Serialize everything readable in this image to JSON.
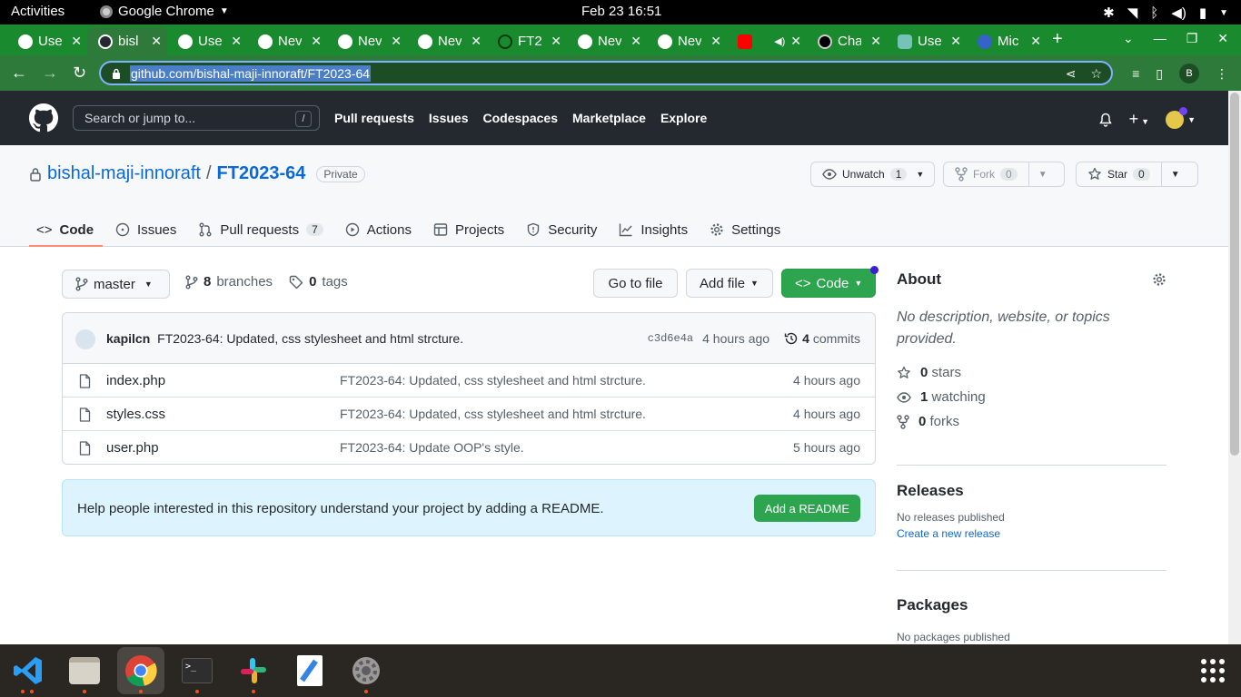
{
  "system": {
    "activities": "Activities",
    "app_name": "Google Chrome",
    "clock": "Feb 23  16:51"
  },
  "tabs": [
    {
      "title": "Use",
      "active": false
    },
    {
      "title": "bisl",
      "active": true
    },
    {
      "title": "Use",
      "active": false
    },
    {
      "title": "Nev",
      "active": false
    },
    {
      "title": "Nev",
      "active": false
    },
    {
      "title": "Nev",
      "active": false
    },
    {
      "title": "FT2",
      "active": false
    },
    {
      "title": "Nev",
      "active": false
    },
    {
      "title": "Nev",
      "active": false
    },
    {
      "title": "",
      "active": false
    },
    {
      "title": "Cha",
      "active": false
    },
    {
      "title": "Use",
      "active": false
    },
    {
      "title": "Mic",
      "active": false
    }
  ],
  "browser": {
    "url": "github.com/bishal-maji-innoraft/FT2023-64",
    "profile_initial": "B"
  },
  "github": {
    "search_placeholder": "Search or jump to...",
    "search_key": "/",
    "nav": [
      "Pull requests",
      "Issues",
      "Codespaces",
      "Marketplace",
      "Explore"
    ]
  },
  "repo": {
    "owner": "bishal-maji-innoraft",
    "separator": "/",
    "name": "FT2023-64",
    "visibility": "Private",
    "unwatch_label": "Unwatch",
    "watch_count": "1",
    "fork_label": "Fork",
    "fork_count": "0",
    "star_label": "Star",
    "star_count": "0",
    "tabs": {
      "code": "Code",
      "issues": "Issues",
      "pulls": "Pull requests",
      "pulls_count": "7",
      "actions": "Actions",
      "projects": "Projects",
      "security": "Security",
      "insights": "Insights",
      "settings": "Settings"
    }
  },
  "branchbar": {
    "branch": "master",
    "branches_count": "8",
    "branches_label": "branches",
    "tags_count": "0",
    "tags_label": "tags",
    "goto_file": "Go to file",
    "add_file": "Add file",
    "code": "Code"
  },
  "latest_commit": {
    "author": "kapilcn",
    "message": "FT2023-64: Updated, css stylesheet and html strcture.",
    "sha": "c3d6e4a",
    "age": "4 hours ago",
    "commits_count": "4",
    "commits_label": "commits"
  },
  "files": [
    {
      "name": "index.php",
      "message": "FT2023-64: Updated, css stylesheet and html strcture.",
      "age": "4 hours ago"
    },
    {
      "name": "styles.css",
      "message": "FT2023-64: Updated, css stylesheet and html strcture.",
      "age": "4 hours ago"
    },
    {
      "name": "user.php",
      "message": "FT2023-64: Update OOP's style.",
      "age": "5 hours ago"
    }
  ],
  "readme": {
    "text": "Help people interested in this repository understand your project by adding a README.",
    "button": "Add a README"
  },
  "about": {
    "title": "About",
    "description": "No description, website, or topics provided.",
    "stars_count": "0",
    "stars_label": "stars",
    "watching_count": "1",
    "watching_label": "watching",
    "forks_count": "0",
    "forks_label": "forks"
  },
  "releases": {
    "title": "Releases",
    "empty": "No releases published",
    "create": "Create a new release"
  },
  "packages": {
    "title": "Packages",
    "empty": "No packages published"
  },
  "colors": {
    "chrome_frame": "#1a8a2e",
    "github_header": "#24292f",
    "primary_green": "#2da44e",
    "link_blue": "#0969da"
  }
}
